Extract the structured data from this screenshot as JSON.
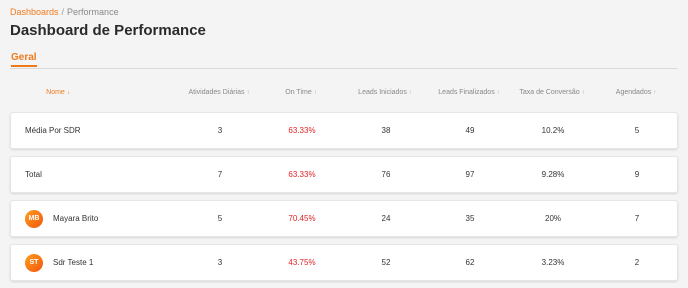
{
  "breadcrumb": {
    "parent": "Dashboards",
    "separator": "/",
    "current": "Performance"
  },
  "page_title": "Dashboard de Performance",
  "tabs": [
    {
      "label": "Geral",
      "active": true
    }
  ],
  "colors": {
    "accent": "#f07a1a",
    "negative": "#e02424",
    "avatar_gradient": [
      "#ff9d1c",
      "#f2560e"
    ]
  },
  "table": {
    "columns": [
      {
        "key": "name",
        "label": "Nome",
        "sort_icon": "arrow-down-icon",
        "active": true
      },
      {
        "key": "atividades",
        "label": "Atividades Diárias",
        "sort_icon": "arrow-up-icon"
      },
      {
        "key": "ontime",
        "label": "On Time",
        "sort_icon": "arrow-up-icon"
      },
      {
        "key": "leads_iniciados",
        "label": "Leads Iniciados",
        "sort_icon": "arrow-up-icon"
      },
      {
        "key": "leads_finalizados",
        "label": "Leads Finalizados",
        "sort_icon": "arrow-up-icon"
      },
      {
        "key": "taxa",
        "label": "Taxa de Conversão",
        "sort_icon": "arrow-up-icon"
      },
      {
        "key": "agendados",
        "label": "Agendados",
        "sort_icon": "arrow-up-icon"
      }
    ],
    "rows": [
      {
        "name": "Média Por SDR",
        "avatar": null,
        "atividades": "3",
        "ontime": "63.33%",
        "leads_iniciados": "38",
        "leads_finalizados": "49",
        "taxa": "10.2%",
        "agendados": "5"
      },
      {
        "name": "Total",
        "avatar": null,
        "atividades": "7",
        "ontime": "63.33%",
        "leads_iniciados": "76",
        "leads_finalizados": "97",
        "taxa": "9.28%",
        "agendados": "9"
      },
      {
        "name": "Mayara Brito",
        "avatar": "MB",
        "atividades": "5",
        "ontime": "70.45%",
        "leads_iniciados": "24",
        "leads_finalizados": "35",
        "taxa": "20%",
        "agendados": "7"
      },
      {
        "name": "Sdr Teste 1",
        "avatar": "ST",
        "atividades": "3",
        "ontime": "43.75%",
        "leads_iniciados": "52",
        "leads_finalizados": "62",
        "taxa": "3.23%",
        "agendados": "2"
      }
    ]
  }
}
